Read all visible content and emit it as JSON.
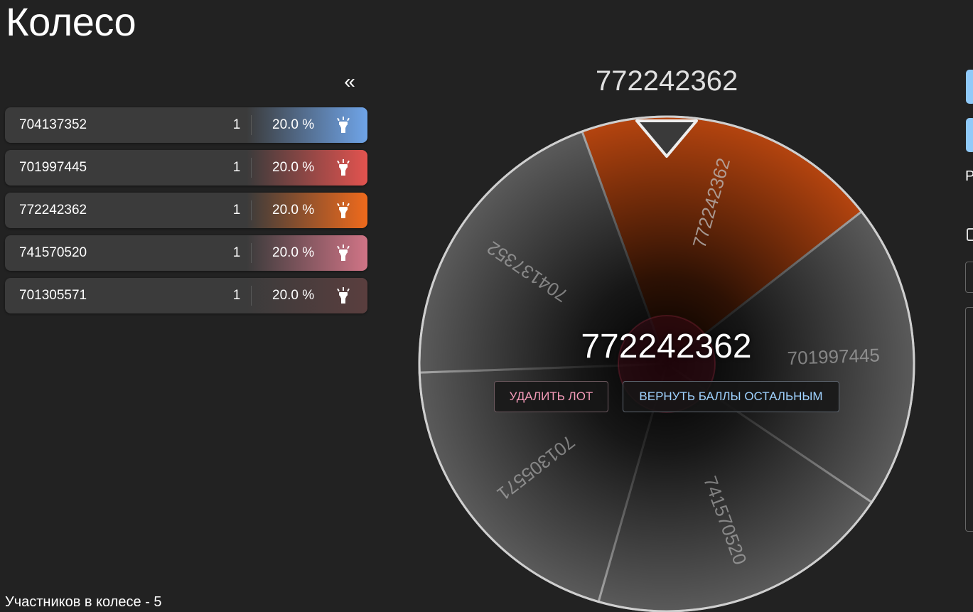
{
  "page": {
    "title": "Колесо"
  },
  "sidebar": {
    "collapse_label": "«",
    "lots": [
      {
        "name": "704137352",
        "amount": "1",
        "percent": "20.0 %",
        "color": "#6fa4e8"
      },
      {
        "name": "701997445",
        "amount": "1",
        "percent": "20.0 %",
        "color": "#e2534f"
      },
      {
        "name": "772242362",
        "amount": "1",
        "percent": "20.0 %",
        "color": "#ef6a1c"
      },
      {
        "name": "741570520",
        "amount": "1",
        "percent": "20.0 %",
        "color": "#d07486"
      },
      {
        "name": "701305571",
        "amount": "1",
        "percent": "20.0 %",
        "color": "#5a3e3e"
      }
    ],
    "participants_text": "Участников в колесе - 5"
  },
  "wheel": {
    "title": "772242362",
    "winner": "772242362",
    "winner_color": "#b4440f",
    "segments": [
      "772242362",
      "701997445",
      "741570520",
      "701305571",
      "704137352"
    ],
    "delete_label": "УДАЛИТЬ ЛОТ",
    "return_label": "ВЕРНУТЬ БАЛЛЫ ОСТАЛЬНЫМ"
  },
  "right_panel": {
    "visible_text": "Р"
  }
}
